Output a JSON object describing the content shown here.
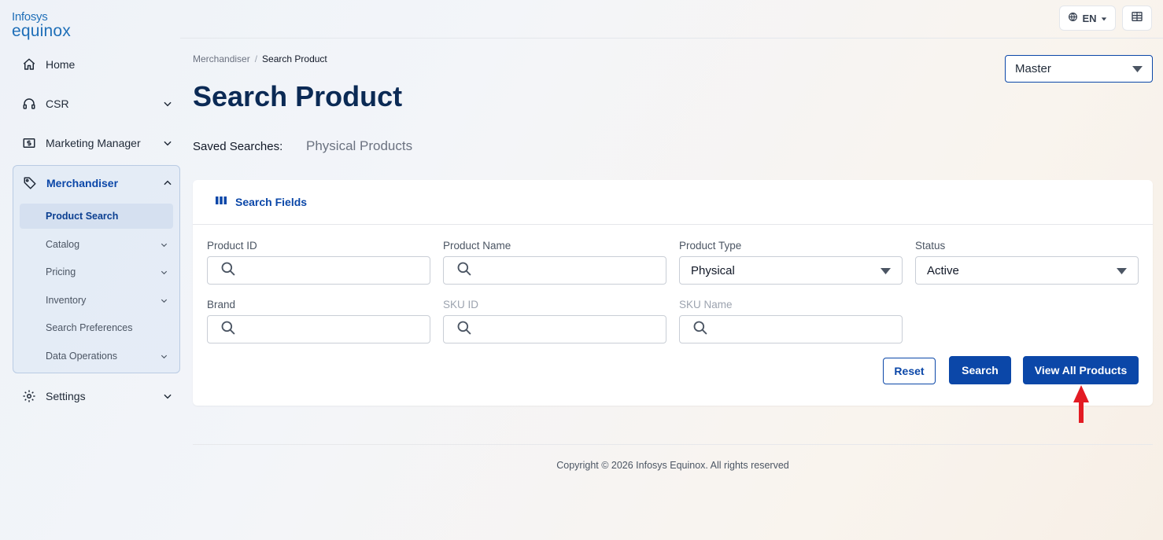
{
  "brand": {
    "line1": "Infosys",
    "line2": "equinox",
    "color": "#1f6fb8"
  },
  "sidebar": {
    "items": [
      {
        "label": "Home",
        "icon": "home-icon"
      },
      {
        "label": "CSR",
        "icon": "headset-icon"
      },
      {
        "label": "Marketing Manager",
        "icon": "dollar-bill-icon"
      }
    ],
    "merchandiser": {
      "label": "Merchandiser",
      "icon": "tag-icon",
      "expanded": true,
      "subitems": [
        {
          "label": "Product Search",
          "active": true
        },
        {
          "label": "Catalog",
          "has_children": true
        },
        {
          "label": "Pricing",
          "has_children": true
        },
        {
          "label": "Inventory",
          "has_children": true
        },
        {
          "label": "Search Preferences",
          "has_children": false
        },
        {
          "label": "Data Operations",
          "has_children": true
        }
      ]
    },
    "settings": {
      "label": "Settings",
      "icon": "gear-icon"
    }
  },
  "topbar": {
    "language": "EN"
  },
  "breadcrumb": {
    "parent": "Merchandiser",
    "separator": "/",
    "current": "Search Product"
  },
  "page": {
    "title": "Search Product",
    "catalog_select": "Master",
    "saved_searches_label": "Saved Searches:",
    "saved_search_link": "Physical Products"
  },
  "search_card": {
    "title": "Search Fields",
    "fields": {
      "product_id": {
        "label": "Product ID",
        "value": ""
      },
      "product_name": {
        "label": "Product Name",
        "value": ""
      },
      "product_type": {
        "label": "Product Type",
        "value": "Physical"
      },
      "status": {
        "label": "Status",
        "value": "Active"
      },
      "brand": {
        "label": "Brand",
        "value": ""
      },
      "sku_id": {
        "label": "SKU ID",
        "value": ""
      },
      "sku_name": {
        "label": "SKU Name",
        "value": ""
      }
    },
    "buttons": {
      "reset": "Reset",
      "search": "Search",
      "view_all": "View All Products"
    }
  },
  "footer": {
    "copyright": "Copyright © 2026 Infosys Equinox. All rights reserved"
  },
  "colors": {
    "primary": "#0b47a8",
    "title": "#0b2a55",
    "annotation_arrow": "#e31b23"
  }
}
